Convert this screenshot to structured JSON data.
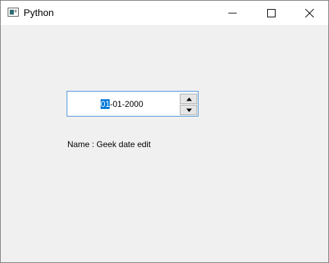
{
  "window": {
    "title": "Python",
    "icons": {
      "app": "python-window-icon",
      "minimize": "minimize-icon",
      "maximize": "maximize-icon",
      "close": "close-icon"
    }
  },
  "date_edit": {
    "selected_section": "01",
    "rest_text": "-01-2000",
    "selection_color": "#0078d7",
    "border_color": "#4a90d9",
    "up_icon": "arrow-up-icon",
    "down_icon": "arrow-down-icon"
  },
  "label": {
    "text": "Name : Geek date edit"
  }
}
